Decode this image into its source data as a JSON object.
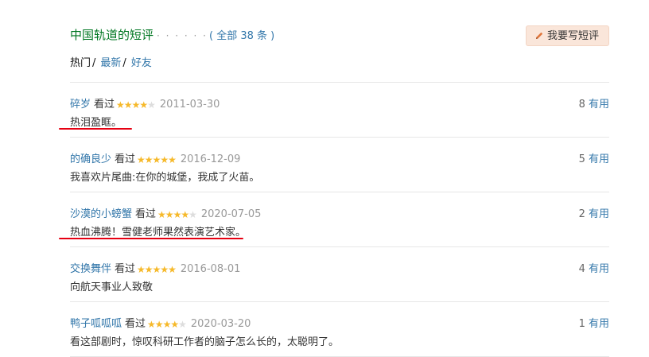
{
  "header": {
    "title": "中国轨道的短评",
    "dots": "· · · · · ·",
    "all_count": "( 全部 38 条 )",
    "write_button": "我要写短评"
  },
  "filters": {
    "hot": "热门",
    "sep1": "/",
    "newest": "最新",
    "sep2": "/",
    "friends": "好友"
  },
  "seen_label": "看过",
  "useful_label": "有用",
  "comments": [
    {
      "user": "碎岁",
      "rating": 4,
      "date": "2011-03-30",
      "text": "热泪盈眶。",
      "votes": "8"
    },
    {
      "user": "的确良少",
      "rating": 5,
      "date": "2016-12-09",
      "text": "我喜欢片尾曲:在你的城堡，我成了火苗。",
      "votes": "5"
    },
    {
      "user": "沙漠的小螃蟹",
      "rating": 4,
      "date": "2020-07-05",
      "text": "热血沸腾！雪健老师果然表演艺术家。",
      "votes": "2"
    },
    {
      "user": "交换舞伴",
      "rating": 5,
      "date": "2016-08-01",
      "text": "向航天事业人致敬",
      "votes": "4"
    },
    {
      "user": "鸭子呱呱呱",
      "rating": 4,
      "date": "2020-03-20",
      "text": "看这部剧时，惊叹科研工作者的脑子怎么长的，太聪明了。",
      "votes": "1"
    }
  ],
  "colors": {
    "title_green": "#007722",
    "link_blue": "#3377aa",
    "star_gold": "#f6b92a",
    "annotation_red": "#e60012",
    "button_bg": "#fae6da"
  }
}
